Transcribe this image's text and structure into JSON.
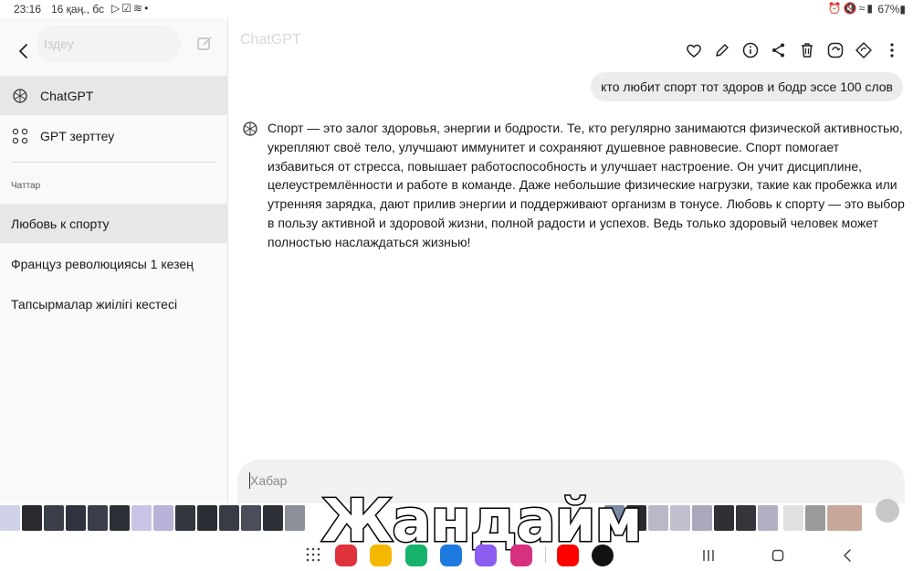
{
  "status_bar": {
    "time": "23:16",
    "date": "16 қаң., бс",
    "left_icons": [
      "play-icon",
      "check-icon",
      "signal-scribble-icon",
      "dot-icon"
    ],
    "right_icons": [
      "alarm-icon",
      "mute-icon",
      "wifi-icon",
      "signal-icon"
    ],
    "battery": "67%"
  },
  "sidebar": {
    "search_placeholder": "Іздеу",
    "items": [
      {
        "label": "ChatGPT",
        "icon": "openai-logo-icon",
        "active": true
      },
      {
        "label": "GPT зерттеу",
        "icon": "grid-dots-icon",
        "active": false
      }
    ],
    "section_label": "Чаттар",
    "chats": [
      {
        "label": "Любовь к спорту",
        "active": true
      },
      {
        "label": "Француз революциясы 1 кезең",
        "active": false
      },
      {
        "label": "Тапсырмалар жиілігі кестесі",
        "active": false
      }
    ]
  },
  "main": {
    "title": "ChatGPT",
    "actions": [
      "heart-icon",
      "pencil-icon",
      "info-icon",
      "share-icon",
      "trash-icon",
      "retry-icon",
      "regenerate-icon",
      "more-vertical-icon"
    ],
    "user_message": "кто любит спорт тот здоров и бодр эссе 100 слов",
    "assistant_message": "Спорт — это залог здоровья, энергии и бодрости. Те, кто регулярно занимаются физической активностью, укрепляют своё тело, улучшают иммунитет и сохраняют душевное равновесие. Спорт помогает избавиться от стресса, повышает работоспособность и улучшает настроение. Он учит дисциплине, целеустремлённости и работе в команде. Даже небольшие физические нагрузки, такие как пробежка или утренняя зарядка, дают прилив энергии и поддерживают организм в тонусе. Любовь к спорту — это выбор в пользу активной и здоровой жизни, полной радости и успехов. Ведь только здоровый человек может полностью наслаждаться жизнью!",
    "composer_placeholder": "Хабар"
  },
  "overlay_text": "Жандайм",
  "dock": {
    "apps": [
      "flipboard-icon",
      "folder-icon",
      "phone-icon",
      "messages-icon",
      "messenger-icon",
      "camera-icon",
      "youtube-icon",
      "tiktok-icon"
    ],
    "nav": [
      "recents-icon",
      "home-icon",
      "back-icon"
    ]
  },
  "colors": {
    "sidebar_bg": "#f9f9f9",
    "active_item_bg": "#e7e7e7",
    "user_bubble_bg": "#ececec",
    "composer_bg": "#f1f1f1"
  }
}
